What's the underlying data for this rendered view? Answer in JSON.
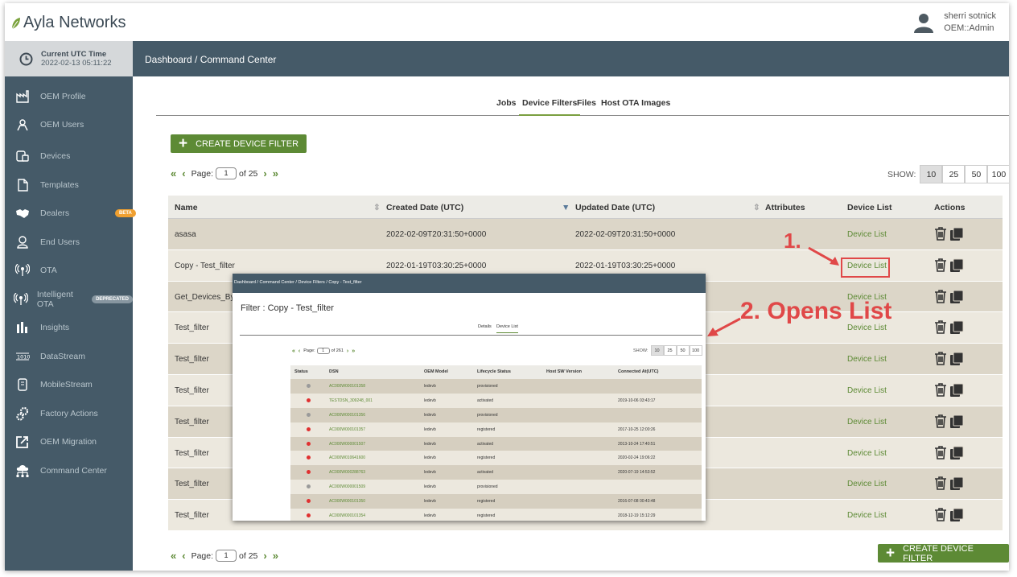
{
  "brand": {
    "name": "Ayla Networks",
    "accent": "#5d8a35",
    "sidebar_bg": "#455a68"
  },
  "user": {
    "name": "sherri sotnick",
    "role": "OEM::Admin"
  },
  "utc": {
    "label": "Current UTC Time",
    "value": "2022-02-13 05:11:22"
  },
  "breadcrumb": "Dashboard / Command Center",
  "sidebar": {
    "items": [
      {
        "label": "OEM Profile",
        "icon": "factory-icon"
      },
      {
        "label": "OEM Users",
        "icon": "user-badge-icon"
      },
      {
        "label": "Devices",
        "icon": "devices-icon"
      },
      {
        "label": "Templates",
        "icon": "document-icon"
      },
      {
        "label": "Dealers",
        "icon": "handshake-icon",
        "badge": "BETA"
      },
      {
        "label": "End Users",
        "icon": "person-icon"
      },
      {
        "label": "OTA",
        "icon": "antenna-icon"
      },
      {
        "label": "Intelligent OTA",
        "icon": "antenna-icon",
        "badge": "DEPRECATED"
      },
      {
        "label": "Insights",
        "icon": "bar-chart-icon"
      },
      {
        "label": "DataStream",
        "icon": "binary-icon"
      },
      {
        "label": "MobileStream",
        "icon": "phone-icon"
      },
      {
        "label": "Factory Actions",
        "icon": "gears-icon"
      },
      {
        "label": "OEM Migration",
        "icon": "export-icon"
      },
      {
        "label": "Command Center",
        "icon": "cloud-network-icon"
      }
    ]
  },
  "tabs": [
    "Jobs",
    "Device Filters",
    "Files",
    "Host OTA Images"
  ],
  "active_tab": "Device Filters",
  "create_button": "CREATE DEVICE FILTER",
  "pager": {
    "label": "Page:",
    "page": "1",
    "of": "of 25"
  },
  "show": {
    "label": "SHOW:",
    "options": [
      "10",
      "25",
      "50",
      "100"
    ],
    "selected": "10"
  },
  "table": {
    "headers": [
      "Name",
      "Created Date (UTC)",
      "Updated Date (UTC)",
      "Attributes",
      "Device List",
      "Actions"
    ],
    "rows": [
      {
        "name": "asasa",
        "created": "2022-02-09T20:31:50+0000",
        "updated": "2022-02-09T20:31:50+0000",
        "link": "Device List"
      },
      {
        "name": "Copy - Test_filter",
        "created": "2022-01-19T03:30:25+0000",
        "updated": "2022-01-19T03:30:25+0000",
        "link": "Device List"
      },
      {
        "name": "Get_Devices_By_",
        "created": "",
        "updated": "",
        "link": "Device List"
      },
      {
        "name": "Test_filter",
        "created": "",
        "updated": "",
        "link": "Device List"
      },
      {
        "name": "Test_filter",
        "created": "",
        "updated": "",
        "link": "Device List"
      },
      {
        "name": "Test_filter",
        "created": "",
        "updated": "",
        "link": "Device List"
      },
      {
        "name": "Test_filter",
        "created": "",
        "updated": "",
        "link": "Device List"
      },
      {
        "name": "Test_filter",
        "created": "",
        "updated": "",
        "link": "Device List"
      },
      {
        "name": "Test_filter",
        "created": "",
        "updated": "",
        "link": "Device List"
      },
      {
        "name": "Test_filter",
        "created": "",
        "updated": "",
        "link": "Device List"
      }
    ]
  },
  "annotations": {
    "step1": "1.",
    "step2": "2. Opens List",
    "color": "#e04848"
  },
  "inset": {
    "breadcrumb": "Dashboard / Command Center / Device Filters / Copy - Test_filter",
    "title": "Filter : Copy - Test_filter",
    "tabs": [
      "Details",
      "Device List"
    ],
    "pager": {
      "label": "Page:",
      "page": "1",
      "of": "of 261"
    },
    "show": {
      "label": "SHOW:",
      "options": [
        "10",
        "25",
        "50",
        "100"
      ]
    },
    "headers": [
      "Status",
      "DSN",
      "OEM Model",
      "Lifecycle Status",
      "Host SW Version",
      "Connected At(UTC)"
    ],
    "rows": [
      {
        "status": "grey",
        "dsn": "AC000W000101358",
        "model": "ledevb",
        "lifecycle": "provisioned",
        "connected": ""
      },
      {
        "status": "red",
        "dsn": "TESTDSN_309248_001",
        "model": "ledevb",
        "lifecycle": "activated",
        "connected": "2019-10-06 03:43:17"
      },
      {
        "status": "grey",
        "dsn": "AC000W000101356",
        "model": "ledevb",
        "lifecycle": "provisioned",
        "connected": ""
      },
      {
        "status": "red",
        "dsn": "AC000W000101357",
        "model": "ledevb",
        "lifecycle": "registered",
        "connected": "2017-10-25 12:00:26"
      },
      {
        "status": "red",
        "dsn": "AC000W000001507",
        "model": "ledevb",
        "lifecycle": "activated",
        "connected": "2013-10-24 17:40:51"
      },
      {
        "status": "red",
        "dsn": "AC000W010641600",
        "model": "ledevb",
        "lifecycle": "registered",
        "connected": "2020-02-24 19:06:22"
      },
      {
        "status": "red",
        "dsn": "AC000W000288763",
        "model": "ledevb",
        "lifecycle": "activated",
        "connected": "2020-07-19 14:53:52"
      },
      {
        "status": "grey",
        "dsn": "AC000W000001509",
        "model": "ledevb",
        "lifecycle": "provisioned",
        "connected": ""
      },
      {
        "status": "red",
        "dsn": "AC000W000101350",
        "model": "ledevb",
        "lifecycle": "registered",
        "connected": "2016-07-08 00:43:48"
      },
      {
        "status": "red",
        "dsn": "AC000W000101354",
        "model": "ledevb",
        "lifecycle": "registered",
        "connected": "2018-12-19 15:12:29"
      }
    ]
  }
}
